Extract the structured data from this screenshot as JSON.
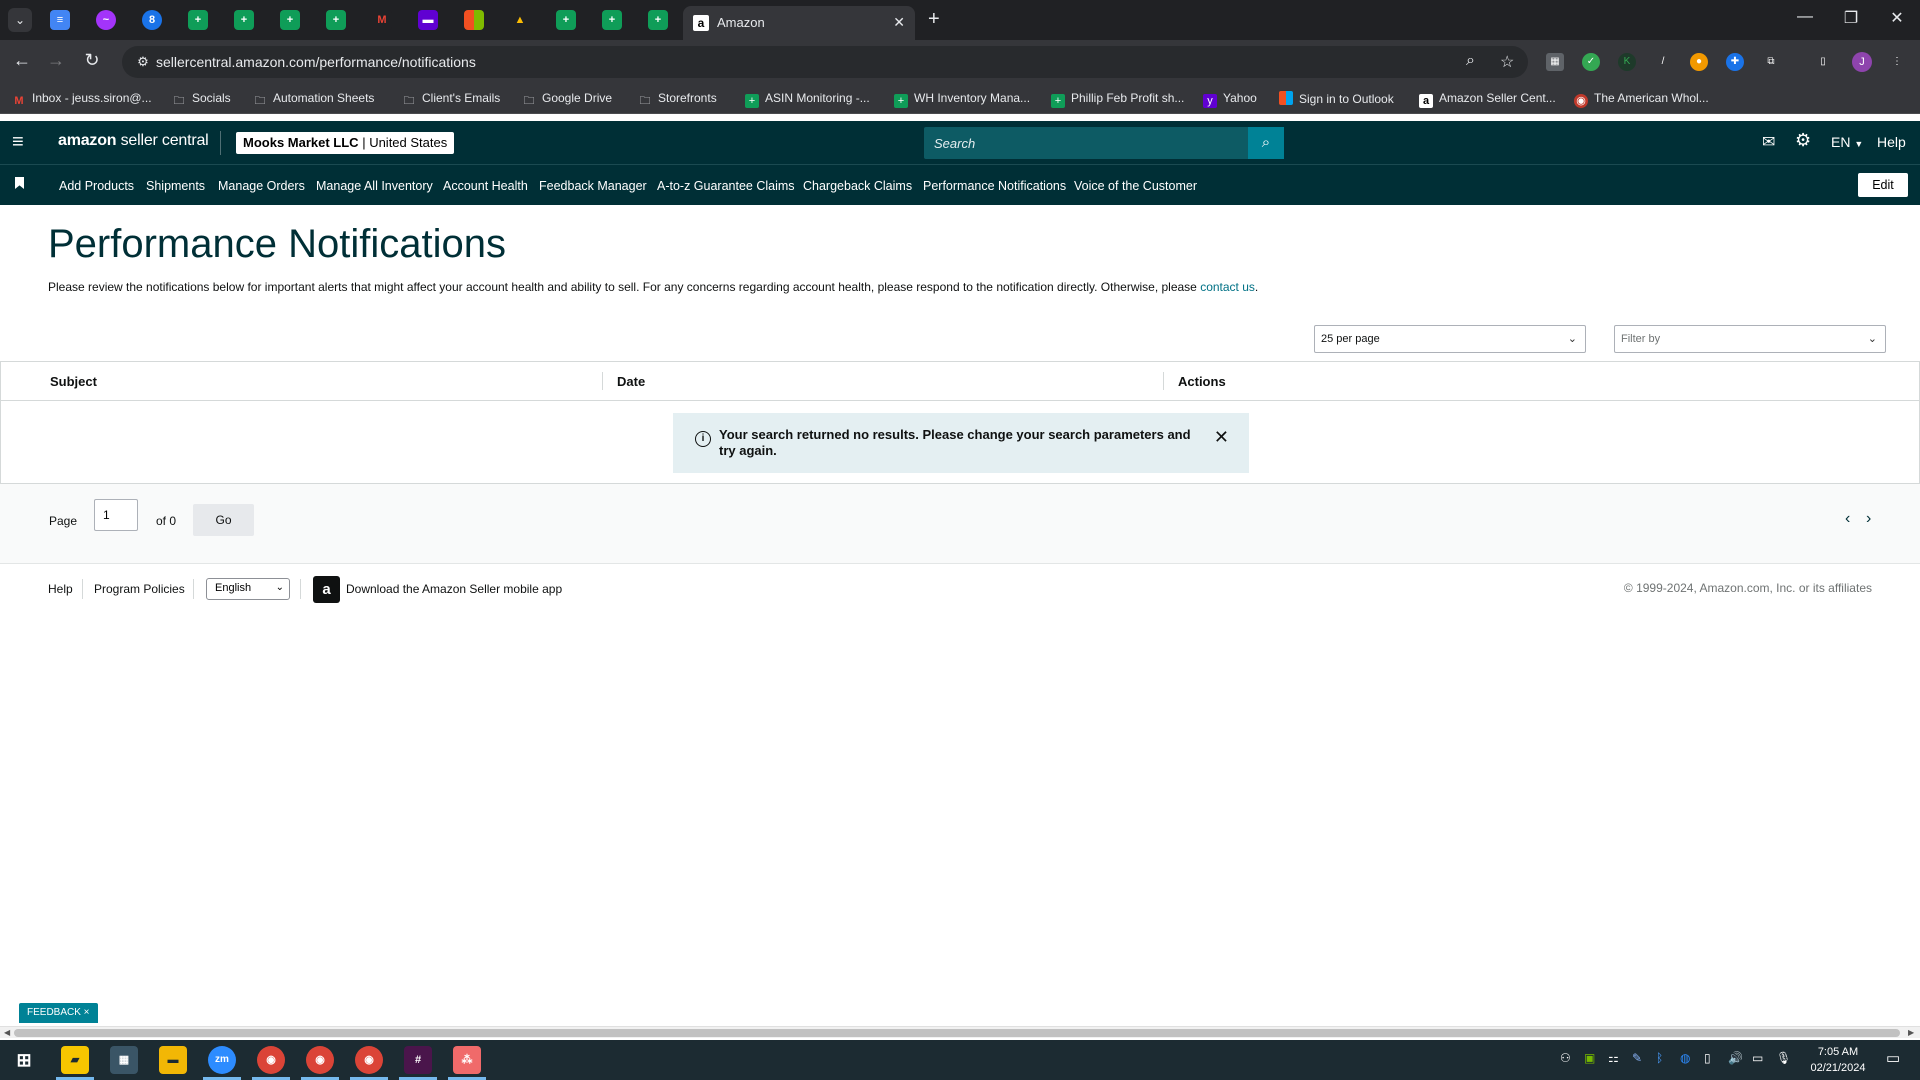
{
  "browser": {
    "active_tab_title": "Amazon",
    "url": "sellercentral.amazon.com/performance/notifications",
    "bookmarks": [
      {
        "label": "Inbox - jeuss.siron@...",
        "icon": "gmail-icon"
      },
      {
        "label": "Socials",
        "icon": "folder-icon"
      },
      {
        "label": "Automation Sheets",
        "icon": "folder-icon"
      },
      {
        "label": "Client's Emails",
        "icon": "folder-icon"
      },
      {
        "label": "Google Drive",
        "icon": "folder-icon"
      },
      {
        "label": "Storefronts",
        "icon": "folder-icon"
      },
      {
        "label": "ASIN Monitoring -...",
        "icon": "sheets-icon"
      },
      {
        "label": "WH Inventory Mana...",
        "icon": "sheets-icon"
      },
      {
        "label": "Phillip Feb Profit sh...",
        "icon": "sheets-icon"
      },
      {
        "label": "Yahoo",
        "icon": "yahoo-icon"
      },
      {
        "label": "Sign in to Outlook",
        "icon": "microsoft-icon"
      },
      {
        "label": "Amazon Seller Cent...",
        "icon": "amazon-icon"
      },
      {
        "label": "The American Whol...",
        "icon": "site-icon"
      }
    ],
    "profile_initial": "J"
  },
  "header": {
    "logo_bold": "amazon",
    "logo_rest": " seller central",
    "store_name": "Mooks Market LLC",
    "store_region": "United States",
    "search_placeholder": "Search",
    "language": "EN",
    "help": "Help"
  },
  "nav": {
    "items": [
      "Add Products",
      "Shipments",
      "Manage Orders",
      "Manage All Inventory",
      "Account Health",
      "Feedback Manager",
      "A-to-z Guarantee Claims",
      "Chargeback Claims",
      "Performance Notifications",
      "Voice of the Customer"
    ],
    "edit_label": "Edit"
  },
  "page": {
    "title": "Performance Notifications",
    "description": "Please review the notifications below for important alerts that might affect your account health and ability to sell. For any concerns regarding account health, please respond to the notification directly. Otherwise, please ",
    "contact_link": "contact us",
    "description_end": ".",
    "per_page": "25 per page",
    "filter_placeholder": "Filter by"
  },
  "table": {
    "columns": [
      "Subject",
      "Date",
      "Actions"
    ],
    "alert_message": "Your search returned no results. Please change your search parameters and try again."
  },
  "pagination": {
    "page_label": "Page",
    "page_value": "1",
    "of_label": "of 0",
    "go_label": "Go"
  },
  "footer": {
    "help": "Help",
    "program_policies": "Program Policies",
    "language": "English",
    "app_download": "Download the Amazon Seller mobile app",
    "copyright": "© 1999-2024, Amazon.com, Inc. or its affiliates"
  },
  "feedback_label": "FEEDBACK ×",
  "taskbar": {
    "time": "7:05 AM",
    "date": "02/21/2024"
  }
}
